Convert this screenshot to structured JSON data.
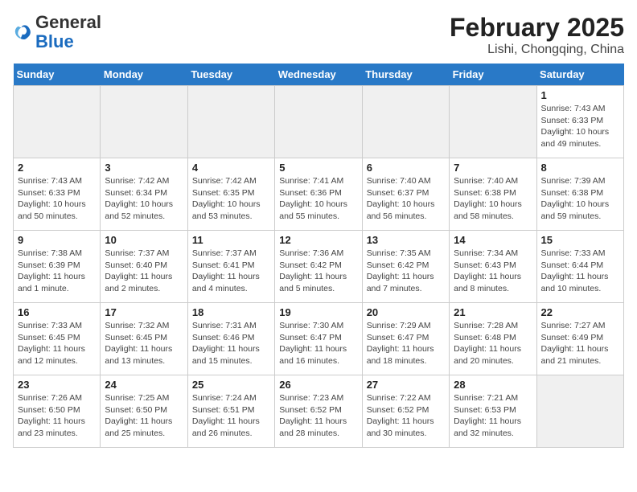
{
  "logo": {
    "general": "General",
    "blue": "Blue"
  },
  "title": "February 2025",
  "subtitle": "Lishi, Chongqing, China",
  "days_of_week": [
    "Sunday",
    "Monday",
    "Tuesday",
    "Wednesday",
    "Thursday",
    "Friday",
    "Saturday"
  ],
  "weeks": [
    [
      {
        "day": "",
        "info": ""
      },
      {
        "day": "",
        "info": ""
      },
      {
        "day": "",
        "info": ""
      },
      {
        "day": "",
        "info": ""
      },
      {
        "day": "",
        "info": ""
      },
      {
        "day": "",
        "info": ""
      },
      {
        "day": "1",
        "info": "Sunrise: 7:43 AM\nSunset: 6:33 PM\nDaylight: 10 hours and 49 minutes."
      }
    ],
    [
      {
        "day": "2",
        "info": "Sunrise: 7:43 AM\nSunset: 6:33 PM\nDaylight: 10 hours and 50 minutes."
      },
      {
        "day": "3",
        "info": "Sunrise: 7:42 AM\nSunset: 6:34 PM\nDaylight: 10 hours and 52 minutes."
      },
      {
        "day": "4",
        "info": "Sunrise: 7:42 AM\nSunset: 6:35 PM\nDaylight: 10 hours and 53 minutes."
      },
      {
        "day": "5",
        "info": "Sunrise: 7:41 AM\nSunset: 6:36 PM\nDaylight: 10 hours and 55 minutes."
      },
      {
        "day": "6",
        "info": "Sunrise: 7:40 AM\nSunset: 6:37 PM\nDaylight: 10 hours and 56 minutes."
      },
      {
        "day": "7",
        "info": "Sunrise: 7:40 AM\nSunset: 6:38 PM\nDaylight: 10 hours and 58 minutes."
      },
      {
        "day": "8",
        "info": "Sunrise: 7:39 AM\nSunset: 6:38 PM\nDaylight: 10 hours and 59 minutes."
      }
    ],
    [
      {
        "day": "9",
        "info": "Sunrise: 7:38 AM\nSunset: 6:39 PM\nDaylight: 11 hours and 1 minute."
      },
      {
        "day": "10",
        "info": "Sunrise: 7:37 AM\nSunset: 6:40 PM\nDaylight: 11 hours and 2 minutes."
      },
      {
        "day": "11",
        "info": "Sunrise: 7:37 AM\nSunset: 6:41 PM\nDaylight: 11 hours and 4 minutes."
      },
      {
        "day": "12",
        "info": "Sunrise: 7:36 AM\nSunset: 6:42 PM\nDaylight: 11 hours and 5 minutes."
      },
      {
        "day": "13",
        "info": "Sunrise: 7:35 AM\nSunset: 6:42 PM\nDaylight: 11 hours and 7 minutes."
      },
      {
        "day": "14",
        "info": "Sunrise: 7:34 AM\nSunset: 6:43 PM\nDaylight: 11 hours and 8 minutes."
      },
      {
        "day": "15",
        "info": "Sunrise: 7:33 AM\nSunset: 6:44 PM\nDaylight: 11 hours and 10 minutes."
      }
    ],
    [
      {
        "day": "16",
        "info": "Sunrise: 7:33 AM\nSunset: 6:45 PM\nDaylight: 11 hours and 12 minutes."
      },
      {
        "day": "17",
        "info": "Sunrise: 7:32 AM\nSunset: 6:45 PM\nDaylight: 11 hours and 13 minutes."
      },
      {
        "day": "18",
        "info": "Sunrise: 7:31 AM\nSunset: 6:46 PM\nDaylight: 11 hours and 15 minutes."
      },
      {
        "day": "19",
        "info": "Sunrise: 7:30 AM\nSunset: 6:47 PM\nDaylight: 11 hours and 16 minutes."
      },
      {
        "day": "20",
        "info": "Sunrise: 7:29 AM\nSunset: 6:47 PM\nDaylight: 11 hours and 18 minutes."
      },
      {
        "day": "21",
        "info": "Sunrise: 7:28 AM\nSunset: 6:48 PM\nDaylight: 11 hours and 20 minutes."
      },
      {
        "day": "22",
        "info": "Sunrise: 7:27 AM\nSunset: 6:49 PM\nDaylight: 11 hours and 21 minutes."
      }
    ],
    [
      {
        "day": "23",
        "info": "Sunrise: 7:26 AM\nSunset: 6:50 PM\nDaylight: 11 hours and 23 minutes."
      },
      {
        "day": "24",
        "info": "Sunrise: 7:25 AM\nSunset: 6:50 PM\nDaylight: 11 hours and 25 minutes."
      },
      {
        "day": "25",
        "info": "Sunrise: 7:24 AM\nSunset: 6:51 PM\nDaylight: 11 hours and 26 minutes."
      },
      {
        "day": "26",
        "info": "Sunrise: 7:23 AM\nSunset: 6:52 PM\nDaylight: 11 hours and 28 minutes."
      },
      {
        "day": "27",
        "info": "Sunrise: 7:22 AM\nSunset: 6:52 PM\nDaylight: 11 hours and 30 minutes."
      },
      {
        "day": "28",
        "info": "Sunrise: 7:21 AM\nSunset: 6:53 PM\nDaylight: 11 hours and 32 minutes."
      },
      {
        "day": "",
        "info": ""
      }
    ]
  ]
}
